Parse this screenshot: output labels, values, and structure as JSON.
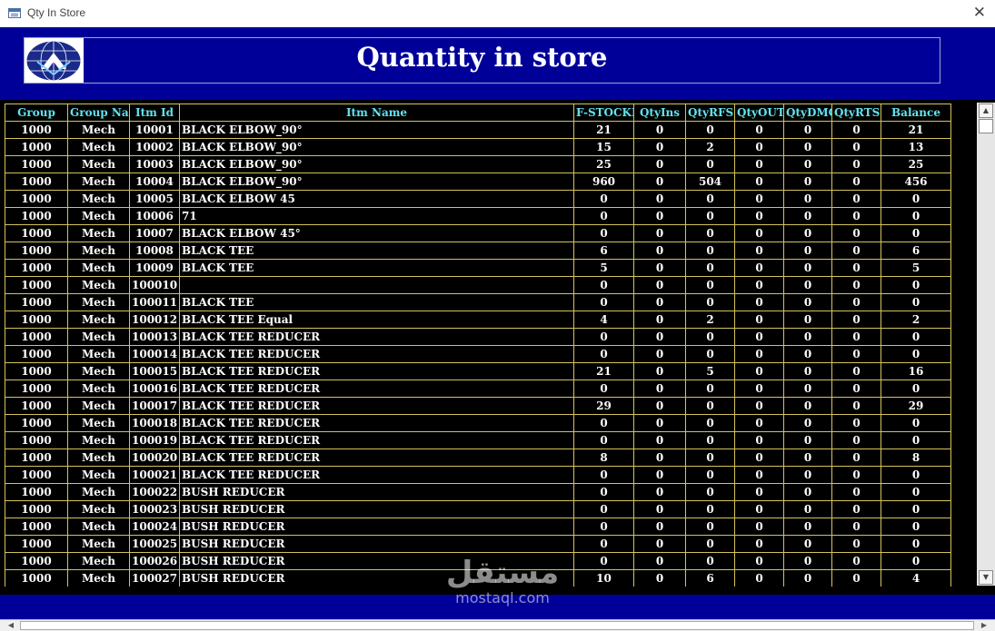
{
  "window": {
    "title": "Qty In Store",
    "close_glyph": "✕"
  },
  "header": {
    "title": "Quantity in store"
  },
  "table": {
    "columns": [
      "Group",
      "Group Name",
      "Itm Id",
      "Itm Name",
      "F-STOCKE",
      "QtyIns",
      "QtyRFS",
      "QtyOUT",
      "QtyDMG",
      "QtyRTS",
      "Balance"
    ],
    "rows": [
      [
        "1000",
        "Mech",
        "10001",
        "BLACK ELBOW_90°",
        "21",
        "0",
        "0",
        "0",
        "0",
        "0",
        "21"
      ],
      [
        "1000",
        "Mech",
        "10002",
        "BLACK ELBOW_90°",
        "15",
        "0",
        "2",
        "0",
        "0",
        "0",
        "13"
      ],
      [
        "1000",
        "Mech",
        "10003",
        "BLACK ELBOW_90°",
        "25",
        "0",
        "0",
        "0",
        "0",
        "0",
        "25"
      ],
      [
        "1000",
        "Mech",
        "10004",
        "BLACK ELBOW_90°",
        "960",
        "0",
        "504",
        "0",
        "0",
        "0",
        "456"
      ],
      [
        "1000",
        "Mech",
        "10005",
        "BLACK ELBOW 45",
        "0",
        "0",
        "0",
        "0",
        "0",
        "0",
        "0"
      ],
      [
        "1000",
        "Mech",
        "10006",
        "71",
        "0",
        "0",
        "0",
        "0",
        "0",
        "0",
        "0"
      ],
      [
        "1000",
        "Mech",
        "10007",
        "BLACK ELBOW 45°",
        "0",
        "0",
        "0",
        "0",
        "0",
        "0",
        "0"
      ],
      [
        "1000",
        "Mech",
        "10008",
        "BLACK TEE",
        "6",
        "0",
        "0",
        "0",
        "0",
        "0",
        "6"
      ],
      [
        "1000",
        "Mech",
        "10009",
        "BLACK TEE",
        "5",
        "0",
        "0",
        "0",
        "0",
        "0",
        "5"
      ],
      [
        "1000",
        "Mech",
        "100010",
        "",
        "0",
        "0",
        "0",
        "0",
        "0",
        "0",
        "0"
      ],
      [
        "1000",
        "Mech",
        "100011",
        "BLACK TEE",
        "0",
        "0",
        "0",
        "0",
        "0",
        "0",
        "0"
      ],
      [
        "1000",
        "Mech",
        "100012",
        "BLACK TEE Equal",
        "4",
        "0",
        "2",
        "0",
        "0",
        "0",
        "2"
      ],
      [
        "1000",
        "Mech",
        "100013",
        "BLACK TEE REDUCER",
        "0",
        "0",
        "0",
        "0",
        "0",
        "0",
        "0"
      ],
      [
        "1000",
        "Mech",
        "100014",
        "BLACK TEE REDUCER",
        "0",
        "0",
        "0",
        "0",
        "0",
        "0",
        "0"
      ],
      [
        "1000",
        "Mech",
        "100015",
        "BLACK TEE REDUCER",
        "21",
        "0",
        "5",
        "0",
        "0",
        "0",
        "16"
      ],
      [
        "1000",
        "Mech",
        "100016",
        "BLACK TEE REDUCER",
        "0",
        "0",
        "0",
        "0",
        "0",
        "0",
        "0"
      ],
      [
        "1000",
        "Mech",
        "100017",
        "BLACK TEE REDUCER",
        "29",
        "0",
        "0",
        "0",
        "0",
        "0",
        "29"
      ],
      [
        "1000",
        "Mech",
        "100018",
        "BLACK TEE REDUCER",
        "0",
        "0",
        "0",
        "0",
        "0",
        "0",
        "0"
      ],
      [
        "1000",
        "Mech",
        "100019",
        "BLACK TEE REDUCER",
        "0",
        "0",
        "0",
        "0",
        "0",
        "0",
        "0"
      ],
      [
        "1000",
        "Mech",
        "100020",
        "BLACK TEE REDUCER",
        "8",
        "0",
        "0",
        "0",
        "0",
        "0",
        "8"
      ],
      [
        "1000",
        "Mech",
        "100021",
        "BLACK TEE REDUCER",
        "0",
        "0",
        "0",
        "0",
        "0",
        "0",
        "0"
      ],
      [
        "1000",
        "Mech",
        "100022",
        "BUSH REDUCER",
        "0",
        "0",
        "0",
        "0",
        "0",
        "0",
        "0"
      ],
      [
        "1000",
        "Mech",
        "100023",
        "BUSH REDUCER",
        "0",
        "0",
        "0",
        "0",
        "0",
        "0",
        "0"
      ],
      [
        "1000",
        "Mech",
        "100024",
        "BUSH REDUCER",
        "0",
        "0",
        "0",
        "0",
        "0",
        "0",
        "0"
      ],
      [
        "1000",
        "Mech",
        "100025",
        "BUSH REDUCER",
        "0",
        "0",
        "0",
        "0",
        "0",
        "0",
        "0"
      ],
      [
        "1000",
        "Mech",
        "100026",
        "BUSH REDUCER",
        "0",
        "0",
        "0",
        "0",
        "0",
        "0",
        "0"
      ],
      [
        "1000",
        "Mech",
        "100027",
        "BUSH REDUCER",
        "10",
        "0",
        "6",
        "0",
        "0",
        "0",
        "4"
      ]
    ]
  },
  "scrollbars": {
    "up_glyph": "▲",
    "down_glyph": "▼",
    "left_glyph": "◀",
    "right_glyph": "▶"
  },
  "watermark": {
    "arabic": "مستقل",
    "latin": "mostaql.com"
  },
  "colors": {
    "header_bg": "#000099",
    "grid_bg": "#000000",
    "grid_border": "#d4c35a",
    "column_header_text": "#5fe4f0",
    "cell_text": "#ffffff"
  },
  "icons": {
    "app": "form-icon",
    "logo": "company-logo-icon",
    "close": "close-icon"
  }
}
